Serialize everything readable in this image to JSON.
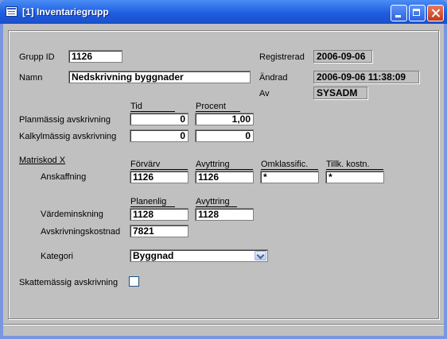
{
  "window": {
    "title": "[1]  Inventariegrupp"
  },
  "form": {
    "grupp_id": {
      "label": "Grupp ID",
      "value": "1126"
    },
    "namn": {
      "label": "Namn",
      "value": "Nedskrivning byggnader"
    },
    "registrerad": {
      "label": "Registrerad",
      "value": "2006-09-06"
    },
    "andrad": {
      "label": "Ändrad",
      "value": "2006-09-06 11:38:09"
    },
    "av": {
      "label": "Av",
      "value": "SYSADM"
    },
    "avskrivning": {
      "headers": {
        "tid": "Tid",
        "procent": "Procent"
      },
      "planmassig": {
        "label": "Planmässig avskrivning",
        "tid": "0",
        "procent": "1,00"
      },
      "kalkylmassig": {
        "label": "Kalkylmässig avskrivning",
        "tid": "0",
        "procent": "0"
      }
    },
    "matriskod": {
      "label": "Matriskod X",
      "headers": {
        "forvarv": "Förvärv",
        "avyttring": "Avyttring",
        "omklassific": "Omklassific.",
        "tillk_kostn": "Tillk. kostn."
      },
      "anskaffning": {
        "label": "Anskaffning",
        "forvarv": "1126",
        "avyttring": "1126",
        "omklassific": "*",
        "tillk_kostn": "*"
      },
      "headers2": {
        "planenlig": "Planenlig",
        "avyttring": "Avyttring"
      },
      "vardeminskning": {
        "label": "Värdeminskning",
        "planenlig": "1128",
        "avyttring": "1128"
      },
      "avskrivningskostnad": {
        "label": "Avskrivningskostnad",
        "value": "7821"
      }
    },
    "kategori": {
      "label": "Kategori",
      "value": "Byggnad"
    },
    "skattemassig": {
      "label": "Skattemässig avskrivning",
      "checked": false
    }
  }
}
